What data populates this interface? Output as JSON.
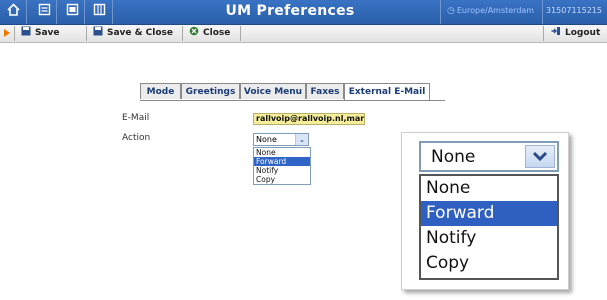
{
  "header": {
    "title": "UM Preferences",
    "timezone": "Europe/Amsterdam",
    "account": "31507115215",
    "icons": [
      "home-icon",
      "list-icon",
      "calendar-icon",
      "grid-icon",
      "clock-icon"
    ]
  },
  "toolbar": {
    "save_label": "Save",
    "save_close_label": "Save & Close",
    "close_label": "Close",
    "logout_label": "Logout"
  },
  "tabs": [
    {
      "label": "Mode",
      "active": false
    },
    {
      "label": "Greetings",
      "active": false
    },
    {
      "label": "Voice Menu",
      "active": false
    },
    {
      "label": "Faxes",
      "active": false
    },
    {
      "label": "External E-Mail",
      "active": true
    }
  ],
  "form": {
    "email_label": "E-Mail",
    "email_value": "rallvoip@rallvoip.nl,marieke@",
    "action_label": "Action",
    "action_selected": "None",
    "action_options": [
      "None",
      "Forward",
      "Notify",
      "Copy"
    ],
    "highlighted_option": "Forward"
  },
  "zoom": {
    "selected": "None",
    "options": [
      "None",
      "Forward",
      "Notify",
      "Copy"
    ],
    "highlighted_option": "Forward"
  },
  "colors": {
    "titlebar": "#2f66b5",
    "highlight": "#3064c6",
    "input_bg": "#f6ee9a",
    "toolbar_arrow": "#f07800"
  }
}
